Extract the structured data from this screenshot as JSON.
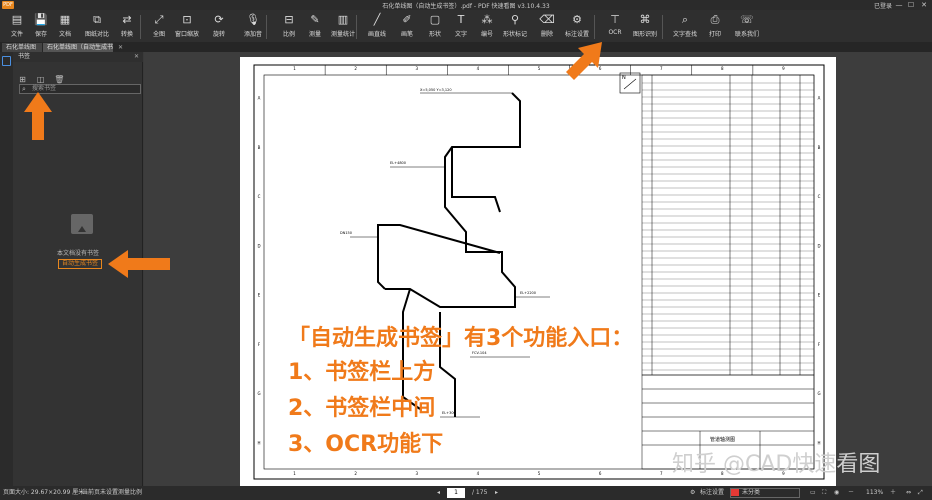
{
  "titlebar": {
    "logo": "PDF",
    "title": "石化单线图（自动生成书签）.pdf - PDF 快速看图 v3.10.4.33",
    "login": "已登录"
  },
  "toolbar": {
    "items": [
      {
        "label": "文件",
        "icon": "file-icon"
      },
      {
        "label": "保存",
        "icon": "save-icon"
      },
      {
        "label": "文档",
        "icon": "document-icon"
      },
      {
        "label": "图纸对比",
        "icon": "compare-icon"
      },
      {
        "label": "转换",
        "icon": "convert-icon"
      },
      {
        "label": "全图",
        "icon": "fit-icon"
      },
      {
        "label": "窗口缩放",
        "icon": "zoom-window-icon"
      },
      {
        "label": "旋转",
        "icon": "rotate-icon"
      },
      {
        "label": "添加音",
        "icon": "voice-icon"
      },
      {
        "label": "比例",
        "icon": "scale-icon"
      },
      {
        "label": "测量",
        "icon": "measure-icon"
      },
      {
        "label": "测量统计",
        "icon": "measure-stats-icon"
      },
      {
        "label": "画直线",
        "icon": "line-icon"
      },
      {
        "label": "画笔",
        "icon": "pen-icon"
      },
      {
        "label": "形状",
        "icon": "shape-icon"
      },
      {
        "label": "文字",
        "icon": "text-icon"
      },
      {
        "label": "编号",
        "icon": "number-icon"
      },
      {
        "label": "形状标记",
        "icon": "shape-mark-icon"
      },
      {
        "label": "删除",
        "icon": "eraser-icon"
      },
      {
        "label": "标注设置",
        "icon": "annotation-settings-icon"
      },
      {
        "label": "OCR",
        "icon": "ocr-icon"
      },
      {
        "label": "图形识别",
        "icon": "shape-recognize-icon"
      },
      {
        "label": "文字查找",
        "icon": "text-search-icon"
      },
      {
        "label": "打印",
        "icon": "print-icon"
      },
      {
        "label": "联系我们",
        "icon": "contact-icon"
      }
    ]
  },
  "tabs": [
    "石化单线图",
    "石化单线图（自动生成书...）"
  ],
  "panel": {
    "title": "书签",
    "search_placeholder": "搜索书签",
    "empty_text": "本文档没有书签",
    "auto_button": "自动生成书签"
  },
  "drawing": {
    "col_labels": [
      "1",
      "2",
      "3",
      "4",
      "5",
      "6",
      "7",
      "8",
      "9"
    ],
    "row_labels": [
      "A",
      "B",
      "C",
      "D",
      "E",
      "F",
      "G",
      "H"
    ],
    "title_block": "管道轴测图"
  },
  "overlay": {
    "line1": "「自动生成书签」有3个功能入口：",
    "line2": "1、书签栏上方",
    "line3": "2、书签栏中间",
    "line4": "3、OCR功能下"
  },
  "watermark": "知乎 @CAD快速看图",
  "status": {
    "page_size": "页面大小: 29.67×20.99 厘米",
    "scale_hint": "当前页未设置测量比例",
    "current_page": "1",
    "total_pages": "/ 175",
    "annotation_label": "标注设置",
    "color_label": "未分类",
    "zoom": "113%"
  },
  "colors": {
    "accent": "#f07a1a",
    "toolbar_bg": "#2f2f2f",
    "canvas_bg": "#3d3d3d"
  }
}
